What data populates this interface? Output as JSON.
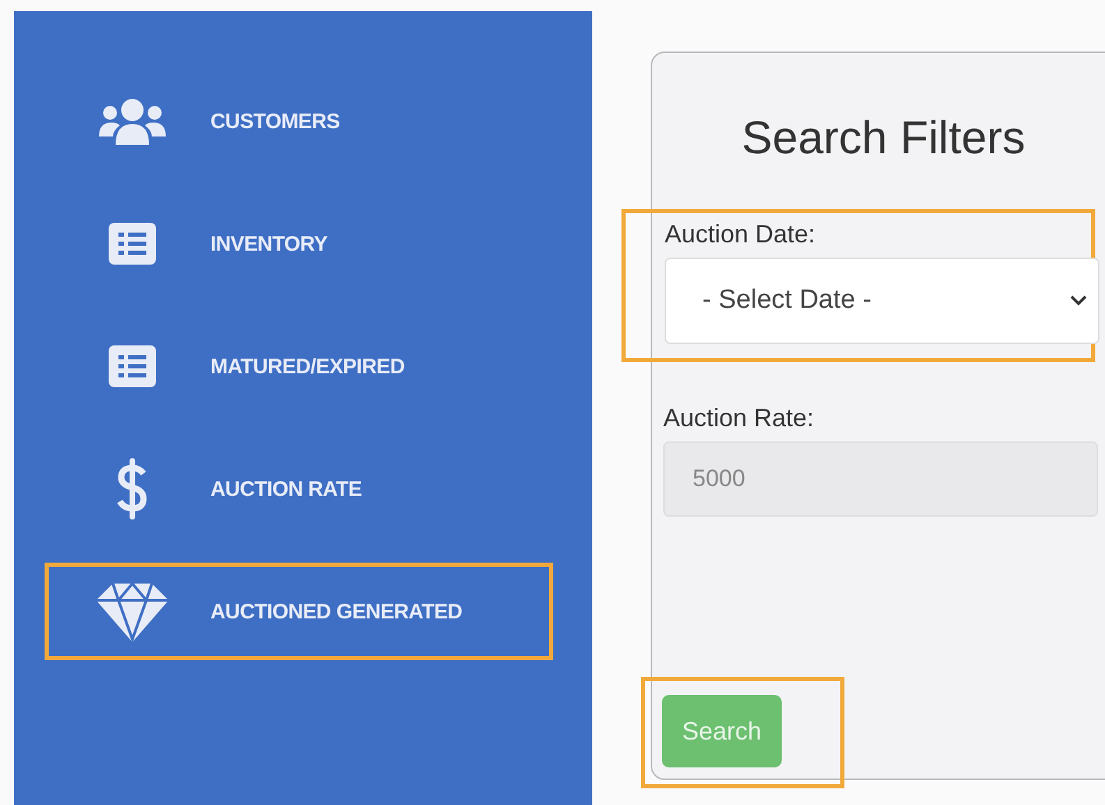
{
  "sidebar": {
    "items": [
      {
        "kind": "users",
        "label": "CUSTOMERS",
        "highlighted": false
      },
      {
        "kind": "list",
        "label": "INVENTORY",
        "highlighted": false
      },
      {
        "kind": "list",
        "label": "MATURED/EXPIRED",
        "highlighted": false
      },
      {
        "kind": "dollar",
        "label": "AUCTION RATE",
        "highlighted": false
      },
      {
        "kind": "diamond",
        "label": "AUCTIONED GENERATED",
        "highlighted": true
      }
    ]
  },
  "filters": {
    "title": "Search Filters",
    "auction_date": {
      "label": "Auction Date:",
      "value": "- Select Date -",
      "highlighted": true
    },
    "auction_rate": {
      "label": "Auction Rate:",
      "value": "5000",
      "disabled": true
    },
    "search_button": {
      "label": "Search",
      "highlighted": true
    }
  }
}
